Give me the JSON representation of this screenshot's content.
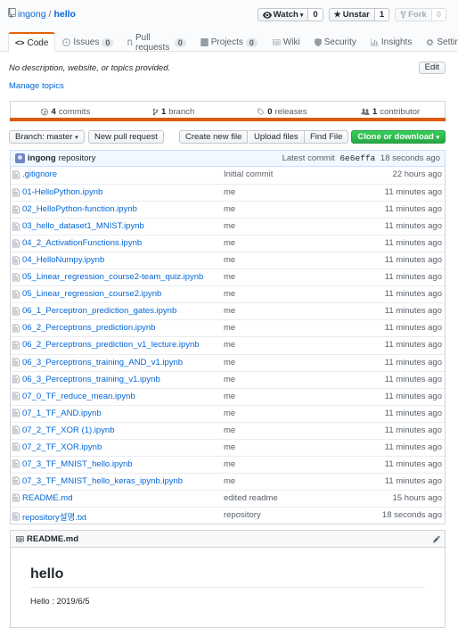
{
  "repo": {
    "owner": "ingong",
    "separator": "/",
    "name": "hello"
  },
  "actions": {
    "watch_label": "Watch",
    "watch_count": "0",
    "star_label": "Unstar",
    "star_count": "1",
    "fork_label": "Fork",
    "fork_count": "0"
  },
  "tabs": [
    {
      "label": "Code",
      "icon": "code-icon",
      "counter": ""
    },
    {
      "label": "Issues",
      "icon": "issue-icon",
      "counter": "0"
    },
    {
      "label": "Pull requests",
      "icon": "pull-request-icon",
      "counter": "0"
    },
    {
      "label": "Projects",
      "icon": "project-icon",
      "counter": "0"
    },
    {
      "label": "Wiki",
      "icon": "book-icon",
      "counter": ""
    },
    {
      "label": "Security",
      "icon": "shield-icon",
      "counter": ""
    },
    {
      "label": "Insights",
      "icon": "graph-icon",
      "counter": ""
    },
    {
      "label": "Settings",
      "icon": "gear-icon",
      "counter": ""
    }
  ],
  "description": "No description, website, or topics provided.",
  "edit_label": "Edit",
  "manage_topics": "Manage topics",
  "summary": {
    "commits_count": "4",
    "commits_label": "commits",
    "branch_count": "1",
    "branch_label": "branch",
    "releases_count": "0",
    "releases_label": "releases",
    "contributor_count": "1",
    "contributor_label": "contributor"
  },
  "language_color": "#da5b0b",
  "file_nav": {
    "branch_label": "Branch: master",
    "new_pr": "New pull request",
    "create_file": "Create new file",
    "upload_files": "Upload files",
    "find_file": "Find File",
    "clone": "Clone or download"
  },
  "latest_commit": {
    "author": "ingong",
    "message": "repository",
    "prefix": "Latest commit",
    "sha": "6e6effa",
    "age": "18 seconds ago"
  },
  "files": [
    {
      "name": ".gitignore",
      "message": "Initial commit",
      "age": "22 hours ago"
    },
    {
      "name": "01-HelloPython.ipynb",
      "message": "me",
      "age": "11 minutes ago"
    },
    {
      "name": "02_HelloPython-function.ipynb",
      "message": "me",
      "age": "11 minutes ago"
    },
    {
      "name": "03_hello_dataset1_MNIST.ipynb",
      "message": "me",
      "age": "11 minutes ago"
    },
    {
      "name": "04_2_ActivationFunctions.ipynb",
      "message": "me",
      "age": "11 minutes ago"
    },
    {
      "name": "04_HelloNumpy.ipynb",
      "message": "me",
      "age": "11 minutes ago"
    },
    {
      "name": "05_Linear_regression_course2-team_quiz.ipynb",
      "message": "me",
      "age": "11 minutes ago"
    },
    {
      "name": "05_Linear_regression_course2.ipynb",
      "message": "me",
      "age": "11 minutes ago"
    },
    {
      "name": "06_1_Perceptron_prediction_gates.ipynb",
      "message": "me",
      "age": "11 minutes ago"
    },
    {
      "name": "06_2_Perceptrons_prediction.ipynb",
      "message": "me",
      "age": "11 minutes ago"
    },
    {
      "name": "06_2_Perceptrons_prediction_v1_lecture.ipynb",
      "message": "me",
      "age": "11 minutes ago"
    },
    {
      "name": "06_3_Perceptrons_training_AND_v1.ipynb",
      "message": "me",
      "age": "11 minutes ago"
    },
    {
      "name": "06_3_Perceptrons_training_v1.ipynb",
      "message": "me",
      "age": "11 minutes ago"
    },
    {
      "name": "07_0_TF_reduce_mean.ipynb",
      "message": "me",
      "age": "11 minutes ago"
    },
    {
      "name": "07_1_TF_AND.ipynb",
      "message": "me",
      "age": "11 minutes ago"
    },
    {
      "name": "07_2_TF_XOR (1).ipynb",
      "message": "me",
      "age": "11 minutes ago"
    },
    {
      "name": "07_2_TF_XOR.ipynb",
      "message": "me",
      "age": "11 minutes ago"
    },
    {
      "name": "07_3_TF_MNIST_hello.ipynb",
      "message": "me",
      "age": "11 minutes ago"
    },
    {
      "name": "07_3_TF_MNIST_hello_keras_ipynb.ipynb",
      "message": "me",
      "age": "11 minutes ago"
    },
    {
      "name": "README.md",
      "message": "edited readme",
      "age": "15 hours ago"
    },
    {
      "name": "repository설명.txt",
      "message": "repository",
      "age": "18 seconds ago"
    }
  ],
  "readme": {
    "header": "README.md",
    "title": "hello",
    "body": "Hello : 2019/6/5"
  }
}
